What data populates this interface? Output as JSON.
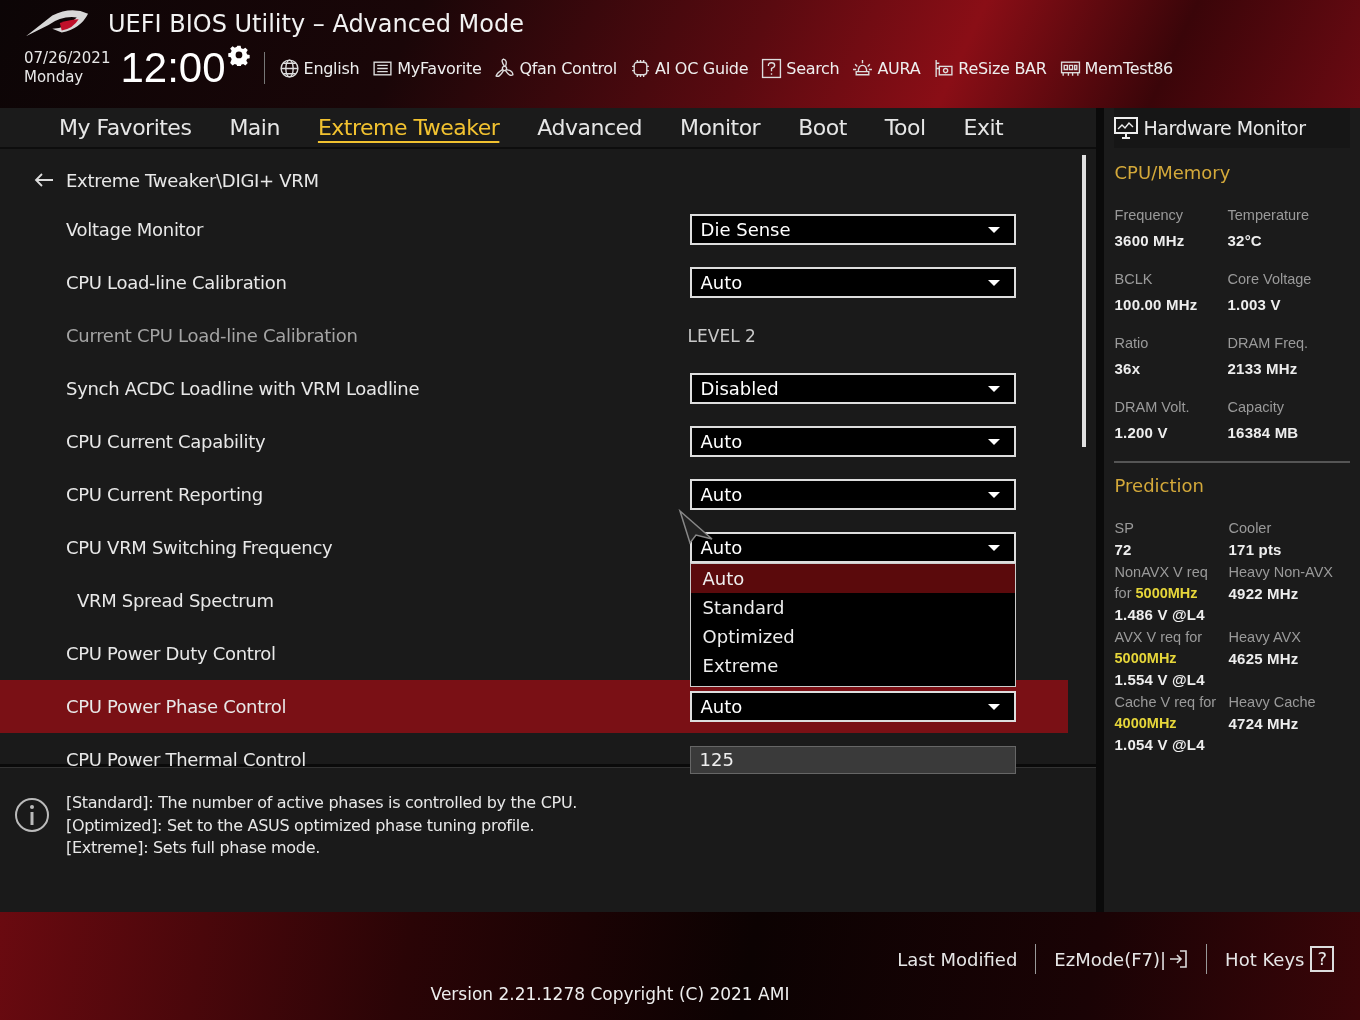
{
  "window": {
    "title": "UEFI BIOS Utility – Advanced Mode"
  },
  "clock": {
    "date": "07/26/2021",
    "weekday": "Monday",
    "time": "12:00"
  },
  "toolbar": [
    "English",
    "MyFavorite",
    "Qfan Control",
    "AI OC Guide",
    "Search",
    "AURA",
    "ReSize BAR",
    "MemTest86"
  ],
  "tabs": [
    {
      "label": "My Favorites",
      "selected": false
    },
    {
      "label": "Main",
      "selected": false
    },
    {
      "label": "Extreme Tweaker",
      "selected": true
    },
    {
      "label": "Advanced",
      "selected": false
    },
    {
      "label": "Monitor",
      "selected": false
    },
    {
      "label": "Boot",
      "selected": false
    },
    {
      "label": "Tool",
      "selected": false
    },
    {
      "label": "Exit",
      "selected": false
    }
  ],
  "breadcrumb": "Extreme Tweaker\\DIGI+ VRM",
  "settings": [
    {
      "label": "Voltage Monitor",
      "kind": "dropdown",
      "value": "Die Sense",
      "selected": false
    },
    {
      "label": "CPU Load-line Calibration",
      "kind": "dropdown",
      "value": "Auto",
      "selected": false
    },
    {
      "label": "Current CPU Load-line Calibration",
      "kind": "readonly",
      "value": "LEVEL 2",
      "selected": false
    },
    {
      "label": "Synch ACDC Loadline with VRM Loadline",
      "kind": "dropdown",
      "value": "Disabled",
      "selected": false
    },
    {
      "label": "CPU Current Capability",
      "kind": "dropdown",
      "value": "Auto",
      "selected": false
    },
    {
      "label": "CPU Current Reporting",
      "kind": "dropdown",
      "value": "Auto",
      "selected": false
    },
    {
      "label": "CPU VRM Switching Frequency",
      "kind": "dropdown",
      "value": "Auto",
      "selected": false,
      "expanded": true,
      "options": [
        {
          "label": "Auto",
          "selected": true
        },
        {
          "label": "Standard",
          "selected": false
        },
        {
          "label": "Optimized",
          "selected": false
        },
        {
          "label": "Extreme",
          "selected": false
        }
      ],
      "children": [
        {
          "label": "VRM Spread Spectrum",
          "selected": false
        }
      ]
    },
    {
      "label": "CPU Power Duty Control",
      "kind": "dropdown",
      "selected": false
    },
    {
      "label": "CPU Power Phase Control",
      "kind": "dropdown",
      "value": "Auto",
      "selected": true
    },
    {
      "label": "CPU Power Thermal Control",
      "kind": "input",
      "value": "125",
      "selected": false
    }
  ],
  "help": [
    "[Standard]: The number of active phases is controlled by the CPU.",
    "[Optimized]: Set to the ASUS optimized phase tuning profile.",
    "[Extreme]: Sets full phase mode."
  ],
  "hardware_monitor": {
    "title": "Hardware Monitor",
    "sections": [
      {
        "title": "CPU/Memory",
        "cells": [
          {
            "label": "Frequency",
            "value": "3600 MHz"
          },
          {
            "label": "Temperature",
            "value": "32°C"
          },
          {
            "label": "BCLK",
            "value": "100.00 MHz"
          },
          {
            "label": "Core Voltage",
            "value": "1.003 V"
          },
          {
            "label": "Ratio",
            "value": "36x"
          },
          {
            "label": "DRAM Freq.",
            "value": "2133 MHz"
          },
          {
            "label": "DRAM Volt.",
            "value": "1.200 V"
          },
          {
            "label": "Capacity",
            "value": "16384 MB"
          }
        ]
      },
      {
        "title": "Prediction",
        "cells": [
          {
            "label": "SP",
            "value": "72"
          },
          {
            "label": "Cooler",
            "value": "171 pts"
          },
          {
            "label": "NonAVX V req for **5000MHz**",
            "value": "1.486 V @L4"
          },
          {
            "label": "Heavy Non-AVX",
            "value": "4922 MHz"
          },
          {
            "label": "AVX V req for **5000MHz**",
            "value": "1.554 V @L4"
          },
          {
            "label": "Heavy AVX",
            "value": "4625 MHz"
          },
          {
            "label": "Cache V req for **4000MHz**",
            "value": "1.054 V @L4"
          },
          {
            "label": "Heavy Cache",
            "value": "4724 MHz"
          }
        ]
      }
    ]
  },
  "footer": {
    "last_modified": "Last Modified",
    "ezmode": "EzMode(F7)|",
    "hot_keys": "Hot Keys",
    "hot_keys_glyph": "?",
    "version": "Version 2.21.1278 Copyright (C) 2021 AMI"
  }
}
